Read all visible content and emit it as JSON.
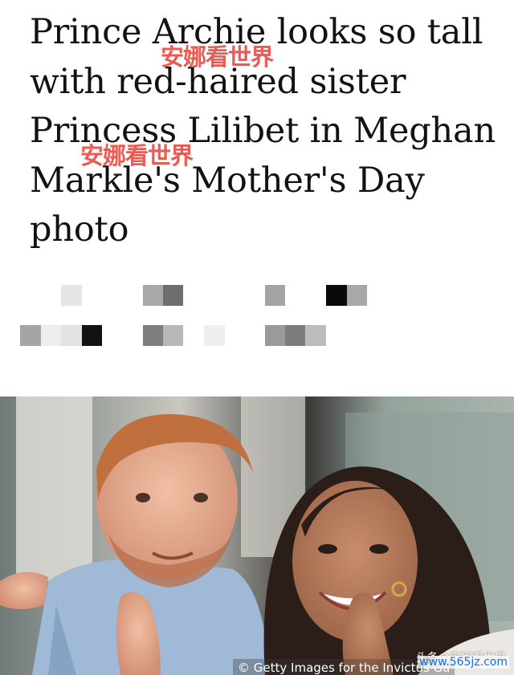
{
  "article": {
    "headline": "Prince Archie looks so tall with red-haired sister Princess Lilibet in Meghan Markle's Mother's Day photo"
  },
  "watermarks": {
    "overlay_1": "安娜看世界",
    "overlay_2": "安娜看世界",
    "source_tag": "头条@安娜看世界",
    "site_url": "www.565jz.com"
  },
  "photo": {
    "credit": "© Getty Images for the Invictus Ga"
  },
  "colors": {
    "headline_text": "#121212",
    "watermark_red": "#e8453c",
    "url_blue": "#1a6fd6"
  }
}
